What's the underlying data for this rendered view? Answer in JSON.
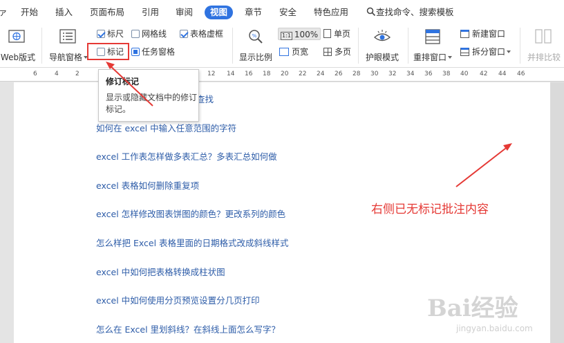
{
  "tabs": [
    {
      "label": "ァ"
    },
    {
      "label": "开始"
    },
    {
      "label": "插入"
    },
    {
      "label": "页面布局"
    },
    {
      "label": "引用"
    },
    {
      "label": "审阅"
    },
    {
      "label": "视图"
    },
    {
      "label": "章节"
    },
    {
      "label": "安全"
    },
    {
      "label": "特色应用"
    }
  ],
  "search": {
    "label": "查找命令、搜索模板"
  },
  "ribbon": {
    "web_layout": "Web版式",
    "nav_pane": "导航窗格",
    "ruler": "标尺",
    "gridlines": "网格线",
    "table_gridlines": "表格虚框",
    "markup": "标记",
    "task_pane": "任务窗格",
    "zoom_label": "显示比例",
    "zoom_value": "100%",
    "single_page": "单页",
    "page_width": "页宽",
    "multi_page": "多页",
    "eye_mode": "护眼模式",
    "arrange_windows": "重排窗口",
    "new_window": "新建窗口",
    "split_window": "拆分窗口",
    "side_by_side": "并排比较",
    "zoom_icon_text": "1:1"
  },
  "ruler_ticks": [
    "6",
    "4",
    "2",
    "12",
    "14",
    "16",
    "18",
    "20",
    "22",
    "24",
    "26",
    "28",
    "30",
    "32",
    "34",
    "36",
    "38",
    "40",
    "42",
    "44",
    "46"
  ],
  "tooltip": {
    "title": "修订标记",
    "body": "显示或隐藏文档中的修订标记。"
  },
  "doc_links": [
    {
      "text": "查找"
    },
    {
      "text": "如何在 excel 中输入任意范围的字符"
    },
    {
      "text": "excel 工作表怎样做多表汇总？多表汇总如何做"
    },
    {
      "text": "excel 表格如何删除重复项"
    },
    {
      "text": "excel 怎样修改图表饼图的颜色？更改系列的颜色"
    },
    {
      "text": "怎么样把 Excel 表格里面的日期格式改成斜线样式"
    },
    {
      "text": "excel 中如何把表格转换成柱状图"
    },
    {
      "text": "excel 中如何使用分页预览设置分几页打印"
    },
    {
      "text": "怎么在 Excel 里划斜线？在斜线上面怎么写字？"
    }
  ],
  "annotation": "右侧已无标记批注内容",
  "watermark": {
    "logo": "Bai经验",
    "url": "jingyan.baidu.com"
  },
  "colors": {
    "accent": "#2f73e0",
    "annotation": "#e53935",
    "link": "#2d5ca8"
  }
}
